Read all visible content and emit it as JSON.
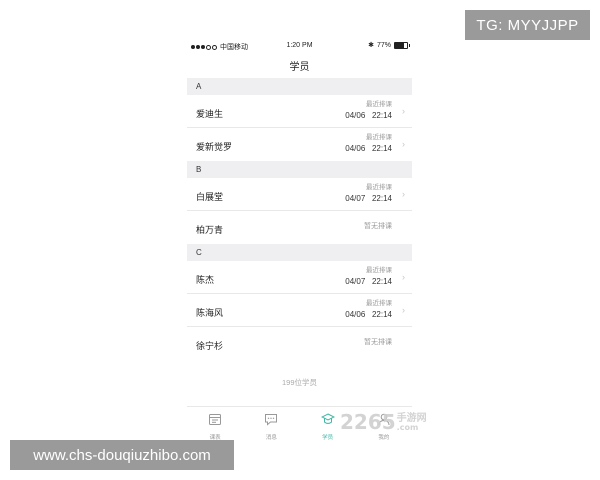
{
  "status_bar": {
    "carrier": "中国移动",
    "time": "1:20 PM",
    "battery": "77%",
    "battery_level": 0.77
  },
  "nav": {
    "title": "学员"
  },
  "sections": [
    {
      "letter": "A",
      "students": [
        {
          "name": "爱迪生",
          "status_label": "最近排课",
          "date": "04/06",
          "time": "22:14",
          "has_chevron": true
        },
        {
          "name": "爱新觉罗",
          "status_label": "最近排课",
          "date": "04/06",
          "time": "22:14",
          "has_chevron": true
        }
      ]
    },
    {
      "letter": "B",
      "students": [
        {
          "name": "白展堂",
          "status_label": "最近排课",
          "date": "04/07",
          "time": "22:14",
          "has_chevron": true
        },
        {
          "name": "柏万青",
          "status_label": "暂无排课",
          "date": "",
          "time": "",
          "has_chevron": false
        }
      ]
    },
    {
      "letter": "C",
      "students": [
        {
          "name": "陈杰",
          "status_label": "最近排课",
          "date": "04/07",
          "time": "22:14",
          "has_chevron": true
        },
        {
          "name": "陈海风",
          "status_label": "最近排课",
          "date": "04/06",
          "time": "22:14",
          "has_chevron": true
        },
        {
          "name": "徐宁杉",
          "status_label": "暂无排课",
          "date": "",
          "time": "",
          "has_chevron": false
        }
      ]
    }
  ],
  "student_count": "199位学员",
  "tabbar": [
    {
      "label": "课表",
      "icon": "calendar-icon",
      "active": false
    },
    {
      "label": "消息",
      "icon": "chat-icon",
      "active": false
    },
    {
      "label": "学员",
      "icon": "graduation-cap-icon",
      "active": true
    },
    {
      "label": "我的",
      "icon": "user-icon",
      "active": false
    }
  ],
  "accent_color": "#3fb8a6",
  "watermarks": {
    "tg": "TG: MYYJJPP",
    "url": "www.chs-douqiuzhibo.com",
    "logo_num": "2265",
    "logo_top": "手游网",
    "logo_bottom": ".com"
  }
}
